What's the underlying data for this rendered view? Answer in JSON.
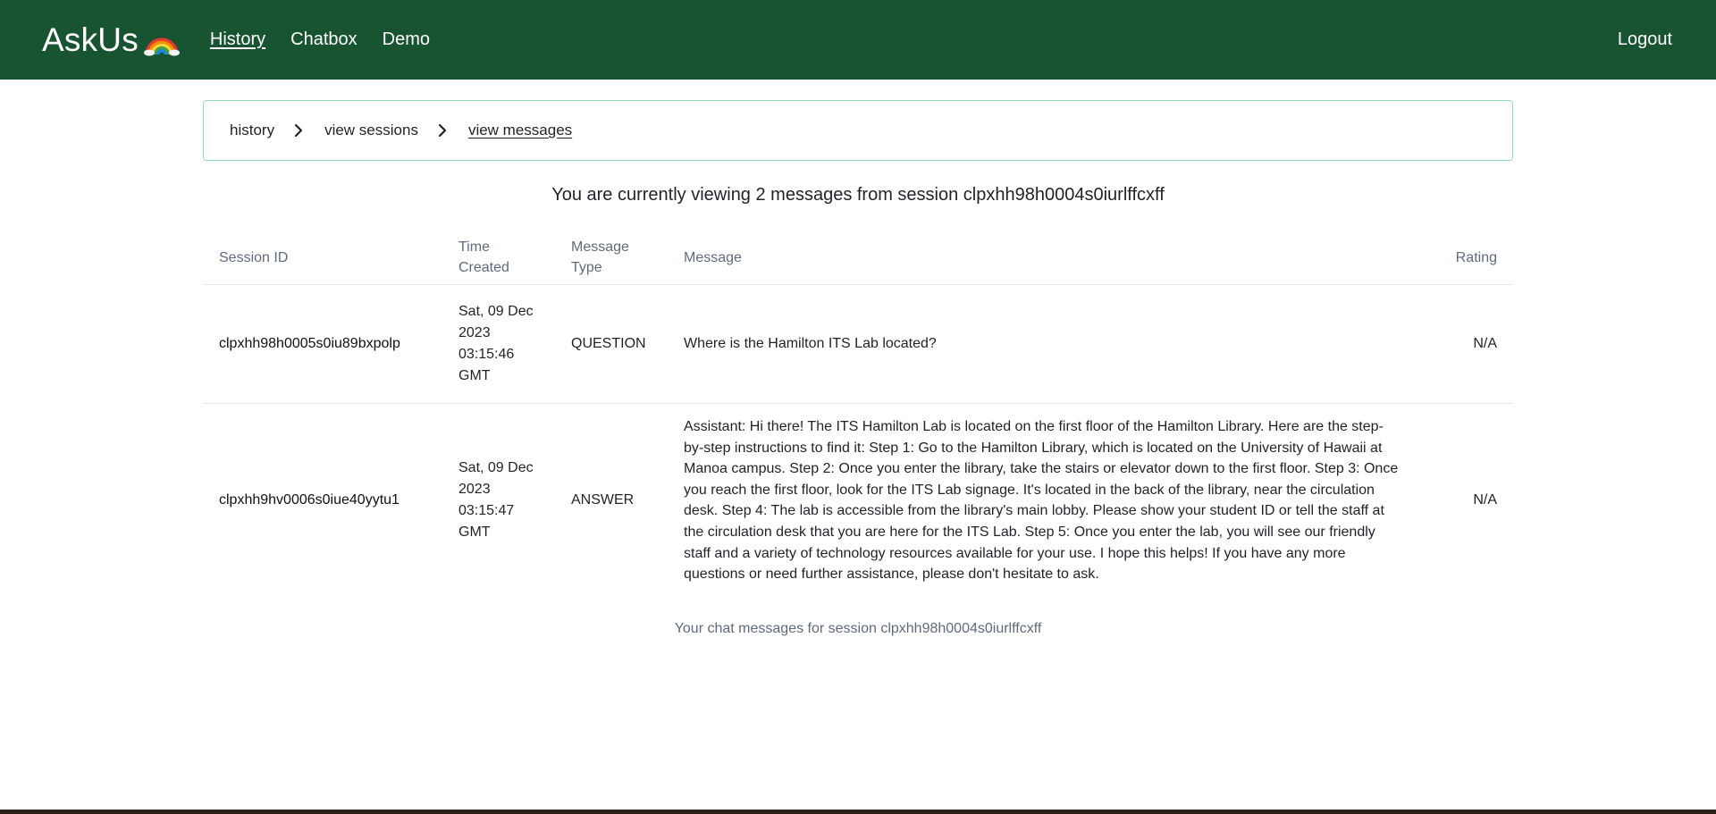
{
  "nav": {
    "brand": "AskUs",
    "links": [
      {
        "label": "History",
        "active": true
      },
      {
        "label": "Chatbox",
        "active": false
      },
      {
        "label": "Demo",
        "active": false
      }
    ],
    "logout": "Logout",
    "bg_color": "#185431"
  },
  "breadcrumb": {
    "items": [
      "history",
      "view sessions",
      "view messages"
    ],
    "border_color": "#8ee0b4"
  },
  "summary": "You are currently viewing 2 messages from session clpxhh98h0004s0iurlffcxff",
  "table": {
    "headers": {
      "session_id": "Session ID",
      "time_created": "Time Created",
      "message_type": "Message Type",
      "message": "Message",
      "rating": "Rating"
    },
    "rows": [
      {
        "session_id": "clpxhh98h0005s0iu89bxpolp",
        "time_created": "Sat, 09 Dec 2023 03:15:46 GMT",
        "message_type": "QUESTION",
        "message": "Where is the Hamilton ITS Lab located?",
        "rating": "N/A"
      },
      {
        "session_id": "clpxhh9hv0006s0iue40yytu1",
        "time_created": "Sat, 09 Dec 2023 03:15:47 GMT",
        "message_type": "ANSWER",
        "message": "Assistant: Hi there! The ITS Hamilton Lab is located on the first floor of the Hamilton Library. Here are the step-by-step instructions to find it: Step 1: Go to the Hamilton Library, which is located on the University of Hawaii at Manoa campus. Step 2: Once you enter the library, take the stairs or elevator down to the first floor. Step 3: Once you reach the first floor, look for the ITS Lab signage. It's located in the back of the library, near the circulation desk. Step 4: The lab is accessible from the library's main lobby. Please show your student ID or tell the staff at the circulation desk that you are here for the ITS Lab. Step 5: Once you enter the lab, you will see our friendly staff and a variety of technology resources available for your use. I hope this helps! If you have any more questions or need further assistance, please don't hesitate to ask.",
        "rating": "N/A"
      }
    ]
  },
  "caption": "Your chat messages for session clpxhh98h0004s0iurlffcxff"
}
